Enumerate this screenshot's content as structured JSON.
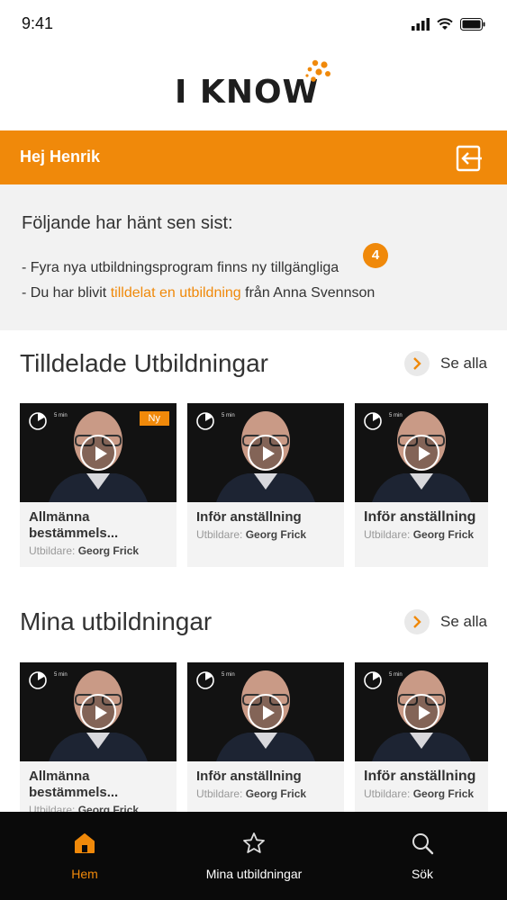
{
  "status": {
    "time": "9:41"
  },
  "logo": {
    "text": "I KNOW",
    "color_accent": "#f0890a"
  },
  "header": {
    "greeting": "Hej Henrik"
  },
  "news": {
    "title": "Följande har hänt sen sist:",
    "line1": "- Fyra nya utbildningsprogram finns ny tillgängliga",
    "line2_prefix": "- Du har blivit ",
    "line2_link": "tilldelat en utbildning",
    "line2_suffix": " från Anna Svennson",
    "badge_count": "4"
  },
  "assigned": {
    "title": "Tilldelade Utbildningar",
    "see_all": "Se alla",
    "cards": [
      {
        "duration": "5 min",
        "badge": "Ny",
        "title": "Allmänna bestämmels...",
        "teacher_label": "Utbildare:",
        "teacher": "Georg Frick"
      },
      {
        "duration": "5 min",
        "title": "Inför anställning",
        "teacher_label": "Utbildare:",
        "teacher": "Georg Frick"
      },
      {
        "duration": "5 min",
        "title": "Inför anställning",
        "teacher_label": "Utbildare:",
        "teacher": "Georg Frick"
      }
    ]
  },
  "mine": {
    "title": "Mina utbildningar",
    "see_all": "Se alla",
    "cards": [
      {
        "duration": "5 min",
        "title": "Allmänna bestämmels...",
        "teacher_label": "Utbildare:",
        "teacher": "Georg Frick"
      },
      {
        "duration": "5 min",
        "title": "Inför anställning",
        "teacher_label": "Utbildare:",
        "teacher": "Georg Frick"
      },
      {
        "duration": "5 min",
        "title": "Inför anställning",
        "teacher_label": "Utbildare:",
        "teacher": "Georg Frick"
      }
    ]
  },
  "tabbar": {
    "items": [
      {
        "label": "Hem",
        "icon": "home-icon",
        "active": true
      },
      {
        "label": "Mina utbildningar",
        "icon": "star-icon",
        "active": false
      },
      {
        "label": "Sök",
        "icon": "search-icon",
        "active": false
      }
    ]
  }
}
